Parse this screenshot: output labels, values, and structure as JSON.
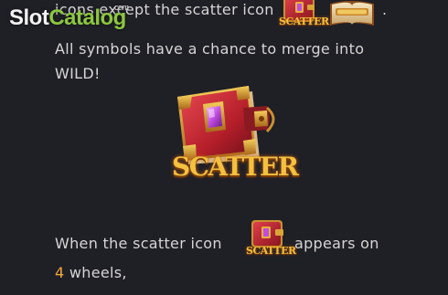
{
  "watermark": {
    "slot": "Slot",
    "catalog": "Catalog",
    "com": ".com"
  },
  "paytable": {
    "line1": "icons except the scatter icon",
    "line1_suffix": ".",
    "line2": "All symbols have a chance to merge into",
    "line3": "WILD!",
    "scatter_label": "SCATTER",
    "line4_before": "When the scatter icon",
    "line4_after": "appears on",
    "line5_number": "4",
    "line5_text": "wheels,"
  },
  "icons": {
    "scatter": "scatter-book-icon",
    "feature": "feature-book-icon"
  },
  "colors": {
    "background": "#1f1f26",
    "text": "#d6d6d6",
    "accent_number": "#f0a93a",
    "scatter_gold": "#f3c040",
    "book_red": "#b5202a",
    "gem_purple": "#c04de0",
    "watermark_green": "#8cc63f"
  }
}
